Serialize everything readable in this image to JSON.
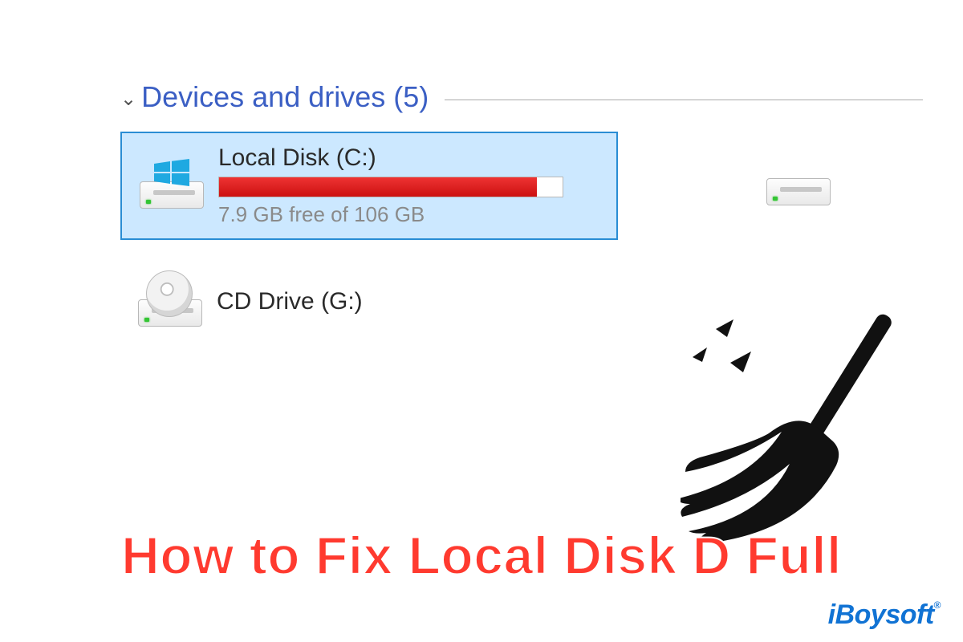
{
  "section": {
    "title": "Devices and drives (5)"
  },
  "drives": {
    "c": {
      "name": "Local Disk (C:)",
      "subtext": "7.9 GB free of 106 GB",
      "fill_percent": 92.5
    },
    "g": {
      "name": "CD Drive (G:)"
    }
  },
  "headline": "How to Fix Local Disk D Full",
  "brand": "iBoysoft",
  "colors": {
    "selection_bg": "#cce8ff",
    "selection_border": "#2a8dd4",
    "bar_fill": "#d62020",
    "headline_color": "#ff3a2f",
    "brand_color": "#1173d4"
  }
}
